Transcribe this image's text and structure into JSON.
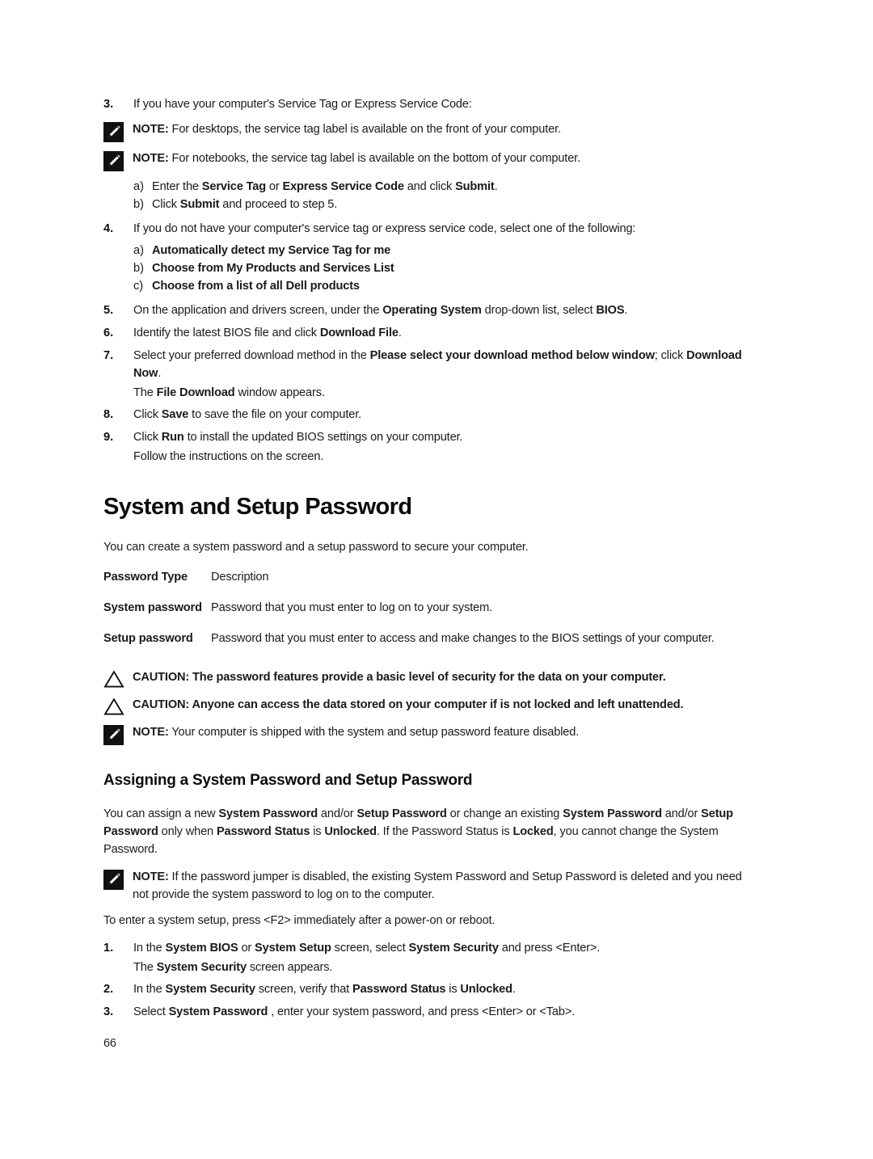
{
  "page": {
    "number": "66"
  },
  "bios_steps": {
    "step3": {
      "num": "3.",
      "text_plain_1": "If you have your computer's Service Tag or Express Service Code:"
    },
    "note_desktops": {
      "lead": "NOTE:",
      "text": " For desktops, the service tag label is available on the front of your computer.",
      "icon": "note-pencil-icon"
    },
    "note_notebooks": {
      "lead": "NOTE:",
      "text": " For notebooks, the service tag label is available on the bottom of your computer.",
      "icon": "note-pencil-icon"
    },
    "step3_sub": [
      {
        "marker": "a)",
        "parts": [
          {
            "t": "Enter the ",
            "b": false
          },
          {
            "t": "Service Tag",
            "b": true
          },
          {
            "t": " or ",
            "b": false
          },
          {
            "t": "Express Service Code",
            "b": true
          },
          {
            "t": " and click ",
            "b": false
          },
          {
            "t": "Submit",
            "b": true
          },
          {
            "t": ".",
            "b": false
          }
        ]
      },
      {
        "marker": "b)",
        "parts": [
          {
            "t": "Click ",
            "b": false
          },
          {
            "t": "Submit",
            "b": true
          },
          {
            "t": " and proceed to step 5.",
            "b": false
          }
        ]
      }
    ],
    "step4": {
      "num": "4.",
      "text": "If you do not have your computer's service tag or express service code, select one of the following:"
    },
    "step4_sub": [
      {
        "marker": "a)",
        "label": "Automatically detect my Service Tag for me"
      },
      {
        "marker": "b)",
        "label": "Choose from My Products and Services List"
      },
      {
        "marker": "c)",
        "label": "Choose from a list of all Dell products"
      }
    ],
    "step5": {
      "num": "5.",
      "parts": [
        {
          "t": "On the application and drivers screen, under the ",
          "b": false
        },
        {
          "t": "Operating System",
          "b": true
        },
        {
          "t": " drop-down list, select ",
          "b": false
        },
        {
          "t": "BIOS",
          "b": true
        },
        {
          "t": ".",
          "b": false
        }
      ]
    },
    "step6": {
      "num": "6.",
      "parts": [
        {
          "t": "Identify the latest BIOS file and click ",
          "b": false
        },
        {
          "t": "Download File",
          "b": true
        },
        {
          "t": ".",
          "b": false
        }
      ]
    },
    "step7": {
      "num": "7.",
      "parts": [
        {
          "t": "Select your preferred download method in the ",
          "b": false
        },
        {
          "t": "Please select your download method below window",
          "b": true
        },
        {
          "t": "; click ",
          "b": false
        },
        {
          "t": "Download Now",
          "b": true
        },
        {
          "t": ".",
          "b": false
        }
      ],
      "followup": [
        {
          "t": "The ",
          "b": false
        },
        {
          "t": "File Download",
          "b": true
        },
        {
          "t": " window appears.",
          "b": false
        }
      ]
    },
    "step8": {
      "num": "8.",
      "parts": [
        {
          "t": "Click ",
          "b": false
        },
        {
          "t": "Save",
          "b": true
        },
        {
          "t": " to save the file on your computer.",
          "b": false
        }
      ]
    },
    "step9": {
      "num": "9.",
      "parts": [
        {
          "t": "Click ",
          "b": false
        },
        {
          "t": "Run",
          "b": true
        },
        {
          "t": " to install the updated BIOS settings on your computer.",
          "b": false
        }
      ],
      "followup": [
        {
          "t": "Follow the instructions on the screen.",
          "b": false
        }
      ]
    }
  },
  "section_password": {
    "heading": "System and Setup Password",
    "intro": "You can create a system password and a setup password to secure your computer.",
    "table": {
      "headers": [
        "Password Type",
        "Description"
      ],
      "rows": [
        {
          "type": "System password",
          "description": "Password that you must enter to log on to your system."
        },
        {
          "type": "Setup password",
          "description": "Password that you must enter to access and make changes to the BIOS settings of your computer."
        }
      ]
    },
    "caution_1": {
      "icon": "caution-triangle-icon",
      "text": "CAUTION: The password features provide a basic level of security for the data on your computer."
    },
    "caution_2": {
      "icon": "caution-triangle-icon",
      "text": "CAUTION: Anyone can access the data stored on your computer if is not locked and left unattended."
    },
    "note_shipped": {
      "icon": "note-pencil-icon",
      "lead": "NOTE:",
      "text": " Your computer is shipped with the system and setup password feature disabled."
    }
  },
  "section_assigning": {
    "heading": "Assigning a System Password and Setup Password",
    "intro_parts": [
      {
        "t": "You can assign a new ",
        "b": false
      },
      {
        "t": "System Password",
        "b": true
      },
      {
        "t": " and/or ",
        "b": false
      },
      {
        "t": "Setup Password",
        "b": true
      },
      {
        "t": " or change an existing ",
        "b": false
      },
      {
        "t": "System Password",
        "b": true
      },
      {
        "t": " and/or ",
        "b": false
      },
      {
        "t": "Setup Password",
        "b": true
      },
      {
        "t": " only when ",
        "b": false
      },
      {
        "t": "Password Status",
        "b": true
      },
      {
        "t": " is ",
        "b": false
      },
      {
        "t": "Unlocked",
        "b": true
      },
      {
        "t": ". If the Password Status is ",
        "b": false
      },
      {
        "t": "Locked",
        "b": true
      },
      {
        "t": ", you cannot change the System Password.",
        "b": false
      }
    ],
    "note_jumper": {
      "icon": "note-pencil-icon",
      "lead": "NOTE:",
      "text": " If the password jumper is disabled, the existing System Password and Setup Password is deleted and you need not provide the system password to log on to the computer."
    },
    "setup_instruction": "To enter a system setup, press <F2> immediately after a power-on or reboot.",
    "steps": [
      {
        "num": "1.",
        "parts": [
          {
            "t": "In the ",
            "b": false
          },
          {
            "t": "System BIOS",
            "b": true
          },
          {
            "t": " or ",
            "b": false
          },
          {
            "t": "System Setup",
            "b": true
          },
          {
            "t": " screen, select ",
            "b": false
          },
          {
            "t": "System Security",
            "b": true
          },
          {
            "t": " and press <Enter>.",
            "b": false
          }
        ],
        "followup": [
          {
            "t": "The ",
            "b": false
          },
          {
            "t": "System Security",
            "b": true
          },
          {
            "t": " screen appears.",
            "b": false
          }
        ]
      },
      {
        "num": "2.",
        "parts": [
          {
            "t": "In the ",
            "b": false
          },
          {
            "t": "System Security",
            "b": true
          },
          {
            "t": " screen, verify that ",
            "b": false
          },
          {
            "t": "Password Status",
            "b": true
          },
          {
            "t": " is ",
            "b": false
          },
          {
            "t": "Unlocked",
            "b": true
          },
          {
            "t": ".",
            "b": false
          }
        ],
        "followup": []
      },
      {
        "num": "3.",
        "parts": [
          {
            "t": "Select ",
            "b": false
          },
          {
            "t": "System Password",
            "b": true
          },
          {
            "t": " , enter your system password, and press <Enter> or <Tab>.",
            "b": false
          }
        ],
        "followup": []
      }
    ]
  },
  "colors": {
    "text": "#1c1c1c",
    "heading": "#0d0d0d",
    "icon_fill": "#111111",
    "page_bg": "#ffffff"
  }
}
